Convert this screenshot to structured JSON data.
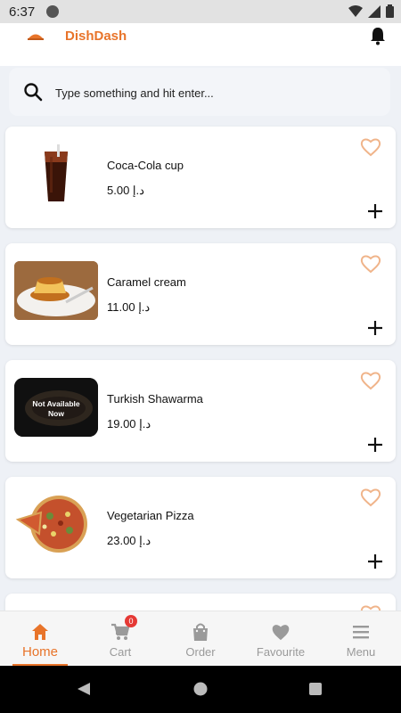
{
  "status_bar": {
    "time": "6:37"
  },
  "header": {
    "brand": "DishDash"
  },
  "search": {
    "placeholder": "Type something and hit enter..."
  },
  "items": [
    {
      "name": "Coca-Cola cup",
      "price": "5.00 د.إ",
      "available": true
    },
    {
      "name": "Caramel cream",
      "price": "11.00 د.إ",
      "available": true
    },
    {
      "name": "Turkish Shawarma",
      "price": "19.00 د.إ",
      "available": false,
      "availability_text": "Not Available Now"
    },
    {
      "name": "Vegetarian Pizza",
      "price": "23.00 د.إ",
      "available": true
    }
  ],
  "nav": {
    "items": [
      {
        "label": "Home",
        "icon": "home-icon"
      },
      {
        "label": "Cart",
        "icon": "cart-icon",
        "badge": "0"
      },
      {
        "label": "Order",
        "icon": "bag-icon"
      },
      {
        "label": "Favourite",
        "icon": "heart-icon"
      },
      {
        "label": "Menu",
        "icon": "menu-icon"
      }
    ]
  },
  "colors": {
    "accent": "#e8742a",
    "badge": "#e53935",
    "fav_outline": "#f0b48a"
  }
}
